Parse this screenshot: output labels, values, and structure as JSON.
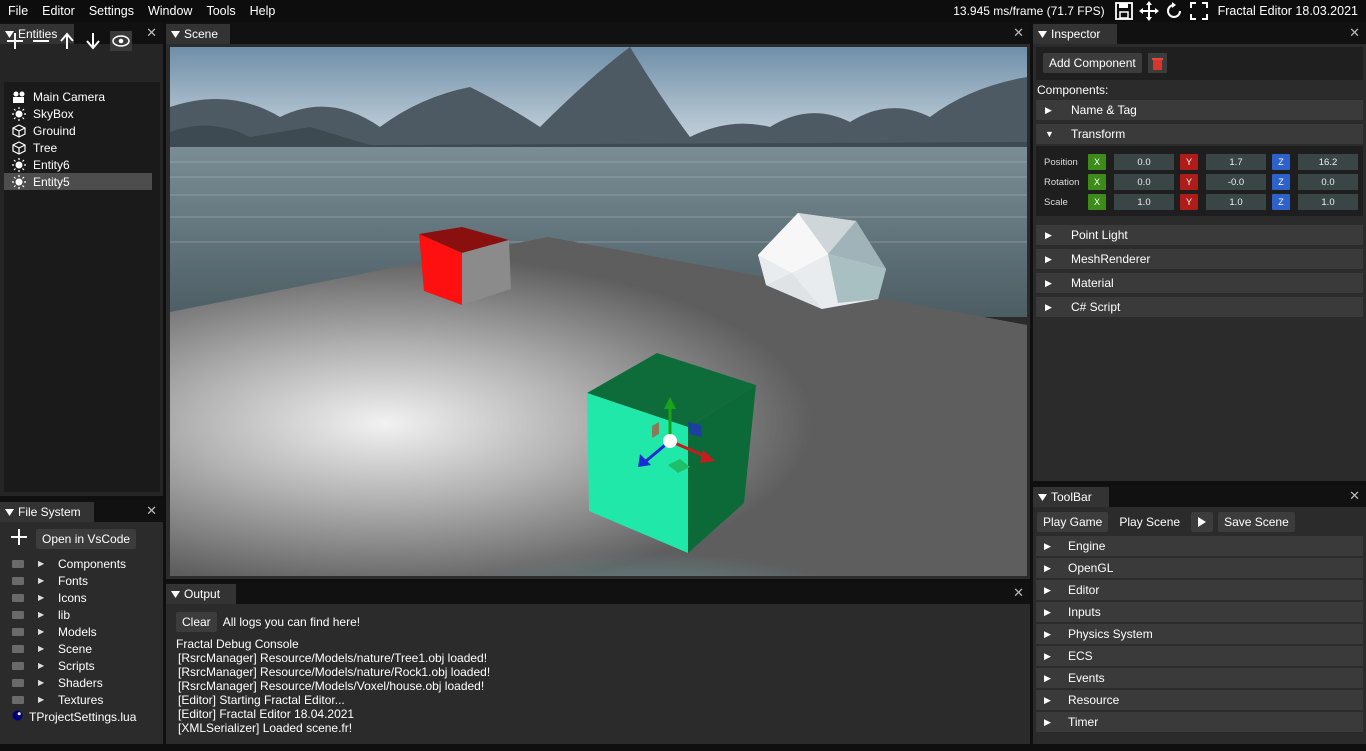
{
  "menu": [
    "File",
    "Editor",
    "Settings",
    "Window",
    "Tools",
    "Help"
  ],
  "status": {
    "fps_text": "13.945 ms/frame (71.7 FPS)",
    "editor_title": "Fractal Editor 18.03.2021"
  },
  "entities": {
    "tab": "Entities",
    "items": [
      {
        "label": "Main Camera",
        "icon": "camera-icon"
      },
      {
        "label": "SkyBox",
        "icon": "light-icon"
      },
      {
        "label": "Grouind",
        "icon": "cube-icon"
      },
      {
        "label": "Tree",
        "icon": "cube-icon"
      },
      {
        "label": "Entity6",
        "icon": "light-icon"
      },
      {
        "label": "Entity5",
        "icon": "light-icon"
      }
    ]
  },
  "filesystem": {
    "tab": "File System",
    "open_vscode": "Open in VsCode",
    "folders": [
      "Components",
      "Fonts",
      "Icons",
      "lib",
      "Models",
      "Scene",
      "Scripts",
      "Shaders",
      "Textures"
    ],
    "file": "TProjectSettings.lua"
  },
  "scene": {
    "tab": "Scene"
  },
  "inspector": {
    "tab": "Inspector",
    "add_component": "Add Component",
    "components_label": "Components:",
    "sections_top": [
      "Name & Tag",
      "Transform"
    ],
    "sections_bottom": [
      "Point Light",
      "MeshRenderer",
      "Material",
      "C# Script"
    ],
    "transform": {
      "position_label": "Position",
      "rotation_label": "Rotation",
      "scale_label": "Scale",
      "position": [
        "0.0",
        "1.7",
        "16.2"
      ],
      "rotation": [
        "0.0",
        "-0.0",
        "0.0"
      ],
      "scale": [
        "1.0",
        "1.0",
        "1.0"
      ],
      "axes": [
        "X",
        "Y",
        "Z"
      ]
    }
  },
  "output": {
    "tab": "Output",
    "clear": "Clear",
    "hint": "All logs you can find here!",
    "title": "Fractal Debug Console",
    "lines": [
      "[RsrcManager] Resource/Models/nature/Tree1.obj loaded!",
      "[RsrcManager] Resource/Models/nature/Rock1.obj loaded!",
      "[RsrcManager] Resource/Models/Voxel/house.obj loaded!",
      "[Editor] Starting Fractal Editor...",
      "[Editor] Fractal Editor 18.04.2021",
      "[XMLSerializer] Loaded scene.fr!"
    ]
  },
  "toolbar": {
    "tab": "ToolBar",
    "play_game": "Play Game",
    "play_scene": "Play Scene",
    "save_scene": "Save Scene",
    "sections": [
      "Engine",
      "OpenGL",
      "Editor",
      "Inputs",
      "Physics System",
      "ECS",
      "Events",
      "Resource",
      "Timer"
    ]
  },
  "colors": {
    "axis_x": "#3d8c1a",
    "axis_y": "#b01c17",
    "axis_z": "#2c62c9",
    "delete_red": "#c0392b"
  }
}
